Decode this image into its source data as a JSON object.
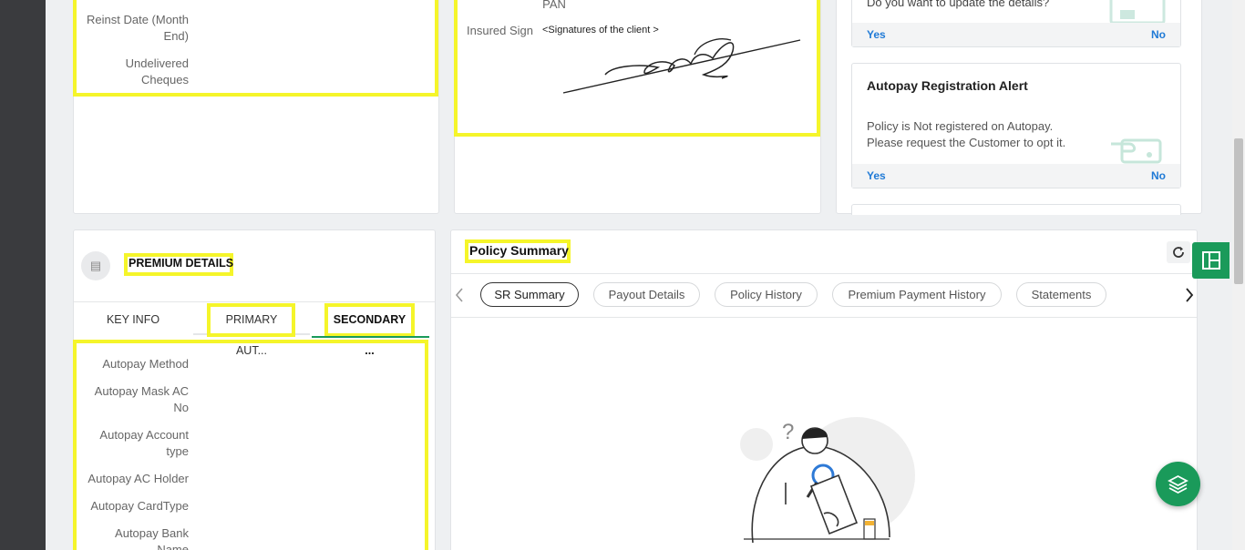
{
  "left_card": {
    "fields": [
      "Reinst Date (Month End)",
      "Undelivered Cheques"
    ]
  },
  "signature_card": {
    "pan_label": "PAN",
    "insured_sign_label": "Insured Sign",
    "signature_caption": "<Signatures of the client >"
  },
  "alerts": [
    {
      "title": "",
      "message": "Do you want to update the details?",
      "yes": "Yes",
      "no": "No"
    },
    {
      "title": "Autopay Registration Alert",
      "message_line1": "Policy is Not registered on Autopay.",
      "message_line2": "Please request the Customer to opt it.",
      "yes": "Yes",
      "no": "No"
    }
  ],
  "premium": {
    "title": "PREMIUM DETAILS",
    "tabs": [
      "KEY INFO",
      "PRIMARY AUT...",
      "SECONDARY ..."
    ],
    "active_tab": "SECONDARY ...",
    "fields": [
      "Autopay Method",
      "Autopay Mask AC No",
      "Autopay Account type",
      "Autopay AC Holder",
      "Autopay CardType",
      "Autopay Bank Name"
    ]
  },
  "policy_summary": {
    "title": "Policy Summary",
    "tabs": [
      "SR Summary",
      "Payout Details",
      "Policy History",
      "Premium Payment History",
      "Statements"
    ],
    "active_tab": "SR Summary"
  },
  "colors": {
    "highlight": "#f5f52a",
    "accent_green": "#1a9a5a",
    "link_blue": "#1f7ad6"
  },
  "icons": [
    "refresh-icon",
    "layout-icon",
    "layers-icon",
    "chevron-left-icon",
    "chevron-right-icon",
    "empty-state-illustration",
    "cheque-icon"
  ]
}
